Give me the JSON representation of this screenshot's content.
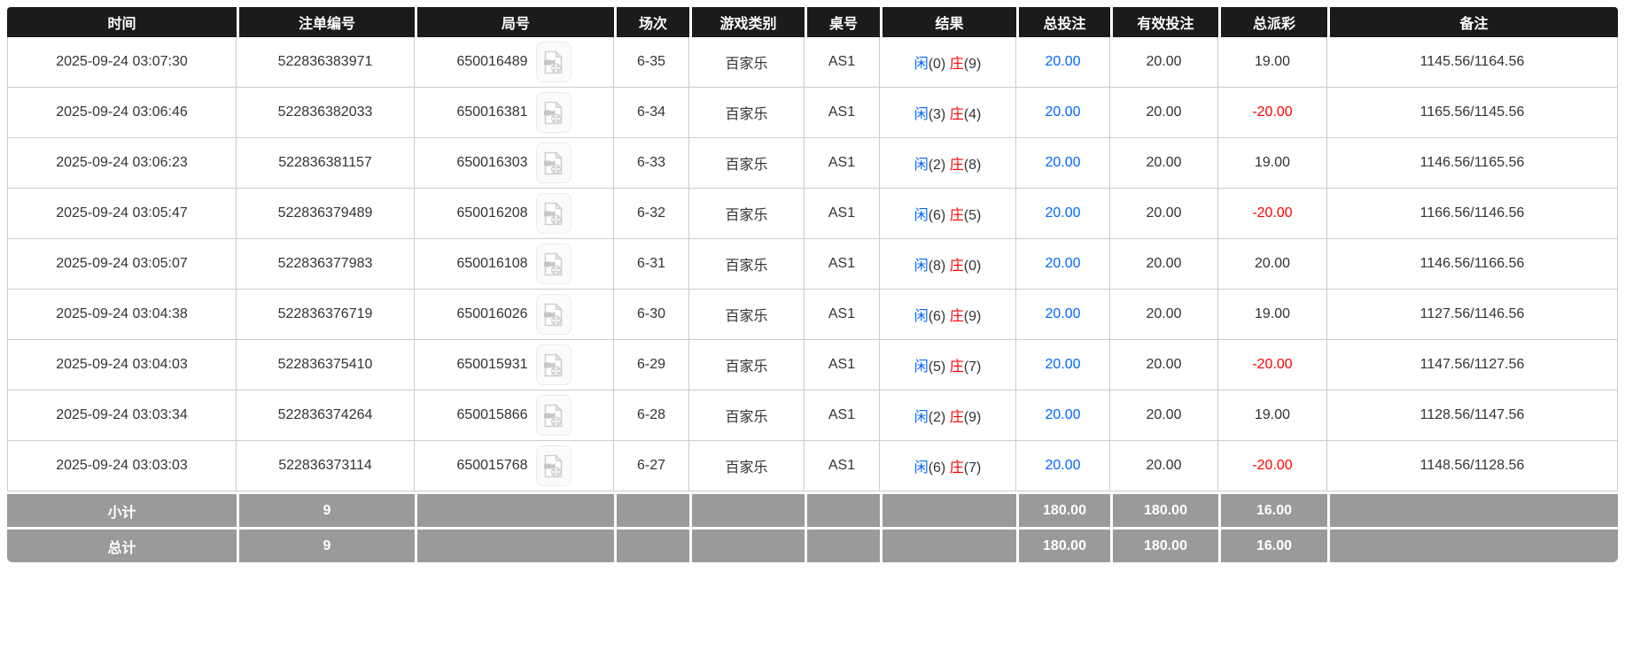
{
  "table": {
    "headers": [
      "时间",
      "注单编号",
      "局号",
      "场次",
      "游戏类别",
      "桌号",
      "结果",
      "总投注",
      "有效投注",
      "总派彩",
      "备注"
    ],
    "game_no_icon": "video-replay-icon",
    "rows": [
      {
        "time": "2025-09-24 03:07:30",
        "bet_id": "522836383971",
        "game_no": "650016489",
        "session": "6-35",
        "game_type": "百家乐",
        "table_no": "AS1",
        "player": "闲",
        "player_score": "(0)",
        "banker": "庄",
        "banker_score": "(9)",
        "total_bet": "20.00",
        "valid_bet": "20.00",
        "payout": "19.00",
        "remark": "1145.56/1164.56"
      },
      {
        "time": "2025-09-24 03:06:46",
        "bet_id": "522836382033",
        "game_no": "650016381",
        "session": "6-34",
        "game_type": "百家乐",
        "table_no": "AS1",
        "player": "闲",
        "player_score": "(3)",
        "banker": "庄",
        "banker_score": "(4)",
        "total_bet": "20.00",
        "valid_bet": "20.00",
        "payout": "-20.00",
        "remark": "1165.56/1145.56"
      },
      {
        "time": "2025-09-24 03:06:23",
        "bet_id": "522836381157",
        "game_no": "650016303",
        "session": "6-33",
        "game_type": "百家乐",
        "table_no": "AS1",
        "player": "闲",
        "player_score": "(2)",
        "banker": "庄",
        "banker_score": "(8)",
        "total_bet": "20.00",
        "valid_bet": "20.00",
        "payout": "19.00",
        "remark": "1146.56/1165.56"
      },
      {
        "time": "2025-09-24 03:05:47",
        "bet_id": "522836379489",
        "game_no": "650016208",
        "session": "6-32",
        "game_type": "百家乐",
        "table_no": "AS1",
        "player": "闲",
        "player_score": "(6)",
        "banker": "庄",
        "banker_score": "(5)",
        "total_bet": "20.00",
        "valid_bet": "20.00",
        "payout": "-20.00",
        "remark": "1166.56/1146.56"
      },
      {
        "time": "2025-09-24 03:05:07",
        "bet_id": "522836377983",
        "game_no": "650016108",
        "session": "6-31",
        "game_type": "百家乐",
        "table_no": "AS1",
        "player": "闲",
        "player_score": "(8)",
        "banker": "庄",
        "banker_score": "(0)",
        "total_bet": "20.00",
        "valid_bet": "20.00",
        "payout": "20.00",
        "remark": "1146.56/1166.56"
      },
      {
        "time": "2025-09-24 03:04:38",
        "bet_id": "522836376719",
        "game_no": "650016026",
        "session": "6-30",
        "game_type": "百家乐",
        "table_no": "AS1",
        "player": "闲",
        "player_score": "(6)",
        "banker": "庄",
        "banker_score": "(9)",
        "total_bet": "20.00",
        "valid_bet": "20.00",
        "payout": "19.00",
        "remark": "1127.56/1146.56"
      },
      {
        "time": "2025-09-24 03:04:03",
        "bet_id": "522836375410",
        "game_no": "650015931",
        "session": "6-29",
        "game_type": "百家乐",
        "table_no": "AS1",
        "player": "闲",
        "player_score": "(5)",
        "banker": "庄",
        "banker_score": "(7)",
        "total_bet": "20.00",
        "valid_bet": "20.00",
        "payout": "-20.00",
        "remark": "1147.56/1127.56"
      },
      {
        "time": "2025-09-24 03:03:34",
        "bet_id": "522836374264",
        "game_no": "650015866",
        "session": "6-28",
        "game_type": "百家乐",
        "table_no": "AS1",
        "player": "闲",
        "player_score": "(2)",
        "banker": "庄",
        "banker_score": "(9)",
        "total_bet": "20.00",
        "valid_bet": "20.00",
        "payout": "19.00",
        "remark": "1128.56/1147.56"
      },
      {
        "time": "2025-09-24 03:03:03",
        "bet_id": "522836373114",
        "game_no": "650015768",
        "session": "6-27",
        "game_type": "百家乐",
        "table_no": "AS1",
        "player": "闲",
        "player_score": "(6)",
        "banker": "庄",
        "banker_score": "(7)",
        "total_bet": "20.00",
        "valid_bet": "20.00",
        "payout": "-20.00",
        "remark": "1148.56/1128.56"
      }
    ],
    "subtotal": {
      "label": "小计",
      "count": "9",
      "total_bet": "180.00",
      "valid_bet": "180.00",
      "payout": "16.00"
    },
    "total": {
      "label": "总计",
      "count": "9",
      "total_bet": "180.00",
      "valid_bet": "180.00",
      "payout": "16.00"
    }
  },
  "colors": {
    "header_bg": "#1b1b1b",
    "footer_bg": "#9a9a9a",
    "border": "#cccccc",
    "text": "#333333",
    "player_blue": "#0066ff",
    "banker_red": "#ff0000",
    "negative_payout_red": "#ff0000"
  }
}
